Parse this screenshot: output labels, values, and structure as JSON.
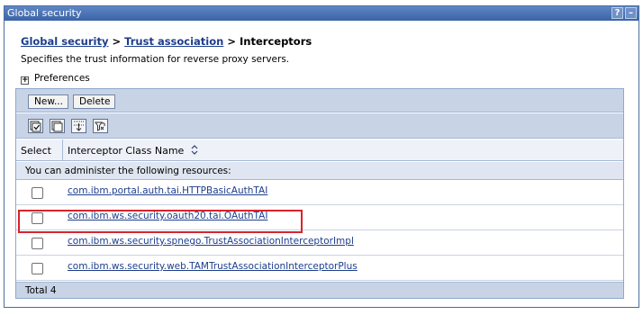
{
  "window": {
    "title": "Global security",
    "help_label": "?",
    "minimize_label": "–"
  },
  "breadcrumb": {
    "items": [
      "Global security",
      "Trust association"
    ],
    "separator": ">",
    "current": "Interceptors"
  },
  "description": "Specifies the trust information for reverse proxy servers.",
  "preferences": {
    "expander": "+",
    "label": "Preferences"
  },
  "toolbar": {
    "new_label": "New...",
    "delete_label": "Delete"
  },
  "icons": {
    "select_all": "select-all-icon",
    "deselect_all": "deselect-all-icon",
    "show_filter": "show-filter-icon",
    "clear_filter": "clear-filter-icon",
    "sort": "sort-icon"
  },
  "table": {
    "columns": [
      "Select",
      "Interceptor Class Name"
    ],
    "info": "You can administer the following resources:",
    "rows": [
      {
        "name": "com.ibm.portal.auth.tai.HTTPBasicAuthTAI",
        "checked": false
      },
      {
        "name": "com.ibm.ws.security.oauth20.tai.OAuthTAI",
        "checked": false,
        "highlighted": true
      },
      {
        "name": "com.ibm.ws.security.spnego.TrustAssociationInterceptorImpl",
        "checked": false
      },
      {
        "name": "com.ibm.ws.security.web.TAMTrustAssociationInterceptorPlus",
        "checked": false
      }
    ],
    "total": "Total 4"
  },
  "colors": {
    "title_bar": "#3b63a6",
    "link": "#1d3d8c",
    "table_band": "#c8d4e6",
    "highlight": "#d9232a"
  }
}
